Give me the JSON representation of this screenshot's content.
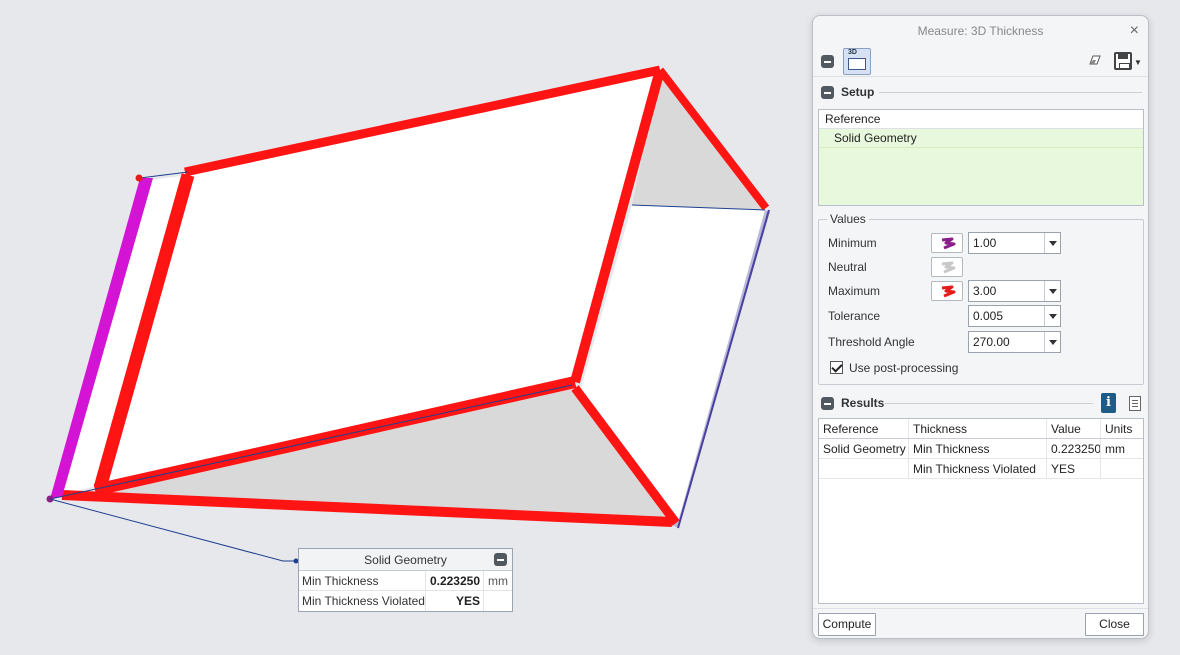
{
  "callout": {
    "title": "Solid Geometry",
    "rows": [
      {
        "label": "Min Thickness",
        "value": "0.223250",
        "unit": "mm"
      },
      {
        "label": "Min Thickness Violated",
        "value": "YES",
        "unit": ""
      }
    ]
  },
  "dialog": {
    "title": "Measure: 3D Thickness",
    "toolbar": {
      "mode_icon_text": "3D"
    },
    "setup": {
      "label": "Setup",
      "reference_header": "Reference",
      "references": [
        "Solid Geometry"
      ]
    },
    "values": {
      "label": "Values",
      "minimum_label": "Minimum",
      "minimum_value": "1.00",
      "neutral_label": "Neutral",
      "maximum_label": "Maximum",
      "maximum_value": "3.00",
      "tolerance_label": "Tolerance",
      "tolerance_value": "0.005",
      "threshold_label": "Threshold Angle",
      "threshold_value": "270.00",
      "postprocess_label": "Use post-processing",
      "postprocess_checked": true
    },
    "results": {
      "label": "Results",
      "headers": [
        "Reference",
        "Thickness",
        "Value",
        "Units"
      ],
      "rows": [
        [
          "Solid Geometry",
          "Min Thickness",
          "0.223250",
          "mm"
        ],
        [
          "",
          "Min Thickness Violated",
          "YES",
          ""
        ]
      ]
    },
    "compute_label": "Compute",
    "close_label": "Close"
  },
  "colors": {
    "min_color": "#8a1f8a",
    "neutral_color": "#c8c8c8",
    "max_color": "#e31b1b",
    "edge_red": "#ff1414",
    "edge_magenta": "#d414d4"
  }
}
